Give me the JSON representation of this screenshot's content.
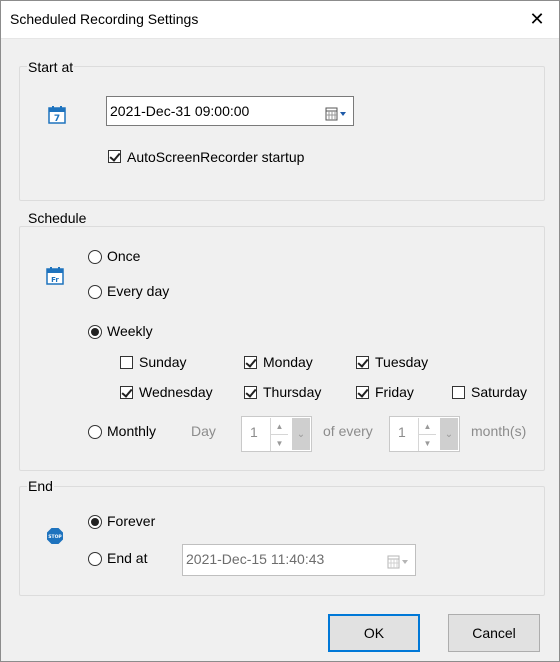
{
  "window": {
    "title": "Scheduled Recording Settings",
    "close_glyph": "✕"
  },
  "start_at": {
    "legend": "Start at",
    "icon": "calendar-7-icon",
    "datetime": "2021-Dec-31 09:00:00",
    "startup_label": "AutoScreenRecorder startup",
    "startup_checked": true
  },
  "schedule": {
    "legend": "Schedule",
    "icon": "calendar-fr-icon",
    "once_label": "Once",
    "every_day_label": "Every day",
    "weekly_label": "Weekly",
    "monthly_label": "Monthly",
    "selected": "Weekly",
    "days": {
      "sunday": {
        "label": "Sunday",
        "checked": false
      },
      "monday": {
        "label": "Monday",
        "checked": true
      },
      "tuesday": {
        "label": "Tuesday",
        "checked": true
      },
      "wednesday": {
        "label": "Wednesday",
        "checked": true
      },
      "thursday": {
        "label": "Thursday",
        "checked": true
      },
      "friday": {
        "label": "Friday",
        "checked": true
      },
      "saturday": {
        "label": "Saturday",
        "checked": false
      }
    },
    "monthly": {
      "day_label": "Day",
      "day_value": "1",
      "of_every_label": "of every",
      "every_value": "1",
      "months_label": "month(s)"
    }
  },
  "end": {
    "legend": "End",
    "icon": "stop-sign-icon",
    "icon_text": "STOP",
    "forever_label": "Forever",
    "end_at_label": "End at",
    "selected": "Forever",
    "end_datetime": "2021-Dec-15 11:40:43"
  },
  "buttons": {
    "ok": "OK",
    "cancel": "Cancel"
  },
  "colors": {
    "accent": "#0078d7",
    "icon_blue": "#1e73be"
  }
}
